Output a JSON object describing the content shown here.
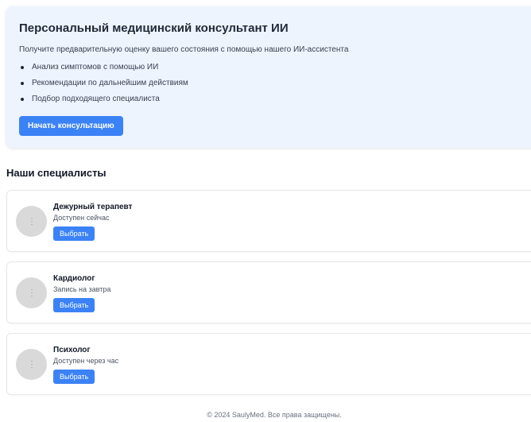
{
  "hero": {
    "title": "Персональный медицинский консультант ИИ",
    "subtitle": "Получите предварительную оценку вашего состояния с помощью нашего ИИ-ассистента",
    "features": [
      "Анализ симптомов с помощью ИИ",
      "Рекомендации по дальнейшим действиям",
      "Подбор подходящего специалиста"
    ],
    "cta_label": "Начать консультацию"
  },
  "specialists": {
    "title": "Наши специалисты",
    "select_label": "Выбрать",
    "items": [
      {
        "name": "Дежурный терапевт",
        "status": "Доступен сейчас"
      },
      {
        "name": "Кардиолог",
        "status": "Запись на завтра"
      },
      {
        "name": "Психолог",
        "status": "Доступен через час"
      }
    ]
  },
  "footer": {
    "text": "© 2024 SaulyMed. Все права защищены."
  },
  "colors": {
    "accent": "#3b82f6",
    "hero_background": "#eef4fe",
    "avatar_placeholder": "#d9d9d9"
  }
}
